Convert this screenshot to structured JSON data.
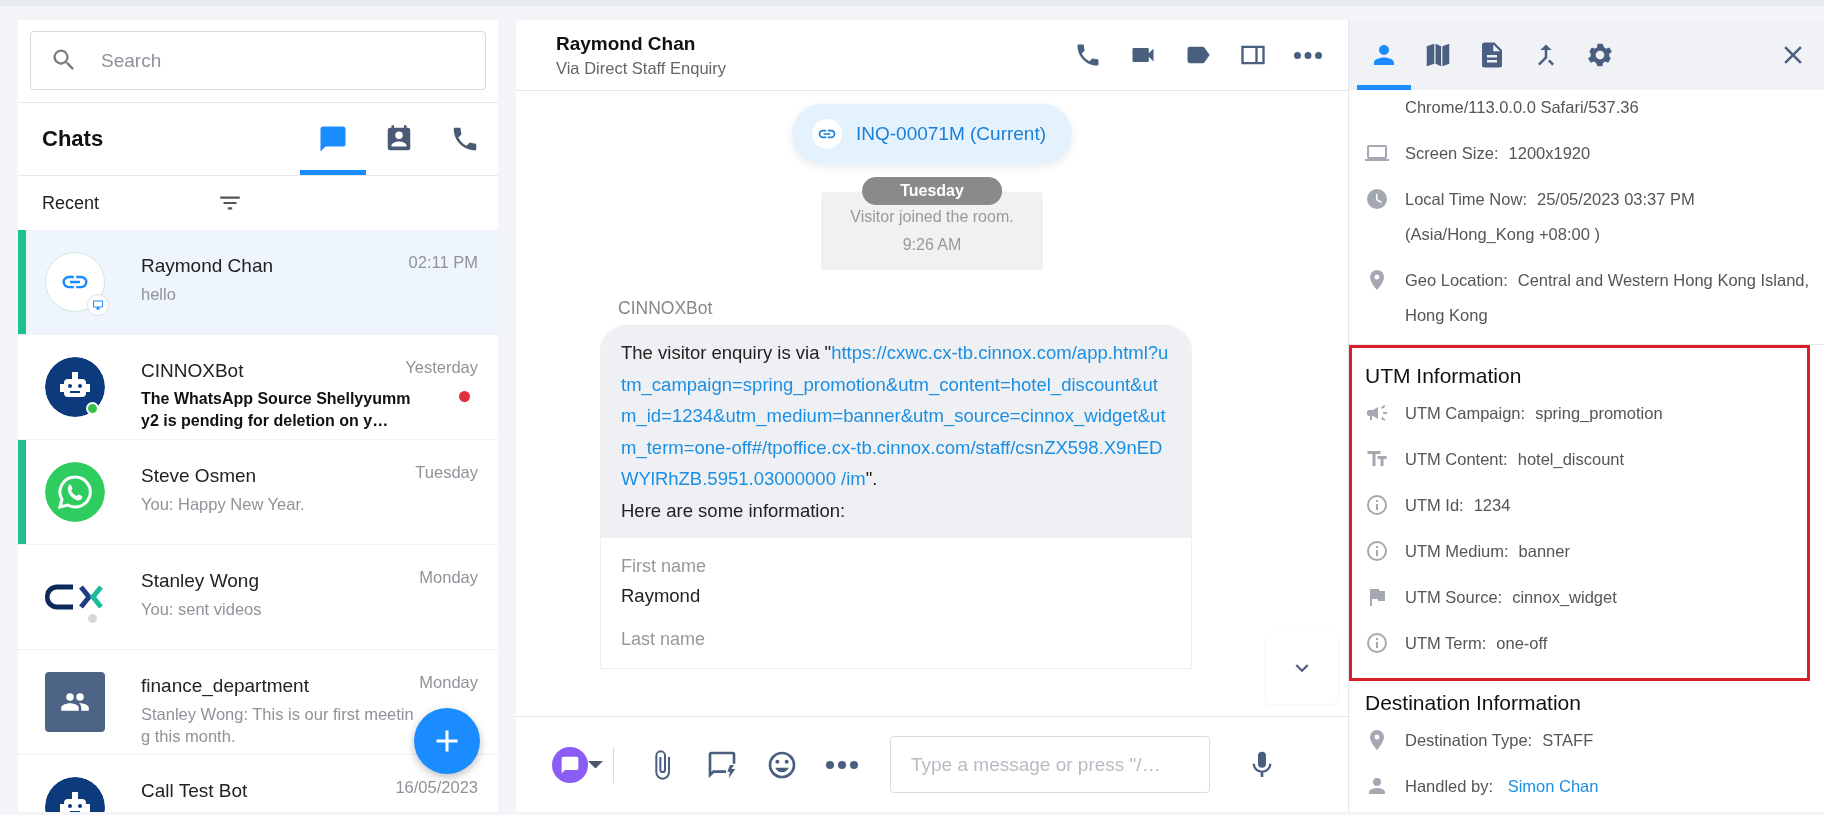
{
  "contact_list": {
    "search": {
      "placeholder": "Search"
    },
    "title": "Chats",
    "tabs": [
      {
        "kind": "chat",
        "selected": true
      },
      {
        "kind": "contacts",
        "selected": false
      },
      {
        "kind": "calls",
        "selected": false
      }
    ],
    "filter_label": "Recent",
    "chats": [
      {
        "name": "Raymond Chan",
        "preview": "hello",
        "time": "02:11 PM",
        "kind": "link",
        "selected": true,
        "accent": true
      },
      {
        "name": "CINNOXBot",
        "preview": "The WhatsApp Source Shellyyummy2 is pending for deletion on y…",
        "time": "Yesterday",
        "kind": "bot",
        "online": true,
        "selected": false,
        "unread": true
      },
      {
        "name": "Steve Osmen",
        "preview": "You: Happy New Year.",
        "time": "Tuesday",
        "kind": "whatsapp",
        "selected": false,
        "accent": true
      },
      {
        "name": "Stanley Wong",
        "preview": "You:  sent videos",
        "time": "Monday",
        "kind": "cx",
        "online": false,
        "selected": false
      },
      {
        "name": "finance_department",
        "preview": "Stanley Wong: This is our first meeting this month.",
        "time": "Monday",
        "kind": "group",
        "selected": false
      },
      {
        "name": "Call Test Bot",
        "time": "16/05/2023",
        "kind": "bot",
        "selected": false
      }
    ]
  },
  "conversation": {
    "name": "Raymond Chan",
    "subtitle": "Via Direct Staff Enquiry",
    "actions": [
      {
        "kind": "call"
      },
      {
        "kind": "video"
      },
      {
        "kind": "tag"
      },
      {
        "kind": "panel"
      },
      {
        "kind": "more"
      }
    ],
    "enquiry": "INQ-00071M (Current)",
    "date": "Tuesday",
    "system_message": "Visitor joined the room.",
    "system_time": "9:26 AM",
    "message": {
      "sender": "CINNOXBot",
      "intro": "The visitor enquiry is via \"",
      "link": "https://cxwc.cx-tb.cinnox.com/app.html?utm_campaign=spring_promotion&utm_content=hotel_discount&utm_id=1234&utm_medium=banner&utm_source=cinnox_widget&utm_term=one-off#/tpoffice.cx-tb.cinnox.com/staff/csnZX598.X9nEDWYlRhZB.5951.03000000  /im",
      "outro": "\".",
      "note": "Here are some information:",
      "fields": [
        {
          "label": "First name",
          "value": "Raymond"
        },
        {
          "label": "Last name"
        }
      ]
    },
    "composer": {
      "placeholder": "Type a message or press \"/…"
    }
  },
  "details": {
    "tabs": [
      {
        "kind": "profile",
        "selected": true
      },
      {
        "kind": "map",
        "selected": false
      },
      {
        "kind": "doc",
        "selected": false
      },
      {
        "kind": "merge",
        "selected": false
      },
      {
        "kind": "gear",
        "selected": false
      }
    ],
    "sections": [
      {
        "highlighted": false,
        "rows": [
          {
            "value": "Chrome/113.0.0.0 Safari/537.36"
          },
          {
            "kind": "laptop",
            "label": "Screen Size:",
            "value": "1200x1920"
          },
          {
            "kind": "clock",
            "label": "Local Time Now:",
            "value": "25/05/2023 03:37 PM (Asia/Hong_Kong +08:00 )"
          },
          {
            "kind": "pin",
            "label": "Geo Location:",
            "value": "Central and Western Hong Kong Island, Hong Kong"
          }
        ]
      },
      {
        "title": "UTM Information",
        "highlighted": true,
        "rows": [
          {
            "kind": "megaphone",
            "label": "UTM Campaign:",
            "value": "spring_promotion"
          },
          {
            "kind": "text",
            "label": "UTM Content:",
            "value": "hotel_discount"
          },
          {
            "kind": "info",
            "label": "UTM Id:",
            "value": "1234"
          },
          {
            "kind": "info",
            "label": "UTM Medium:",
            "value": "banner"
          },
          {
            "kind": "flag",
            "label": "UTM Source:",
            "value": "cinnox_widget"
          },
          {
            "kind": "info",
            "label": "UTM Term:",
            "value": "one-off"
          }
        ]
      },
      {
        "title": "Destination Information",
        "highlighted": false,
        "rows": [
          {
            "kind": "pin",
            "label": "Destination Type:",
            "value": "STAFF"
          },
          {
            "kind": "person",
            "label": "Handled by:",
            "value": "Simon Chan",
            "link": true
          }
        ]
      }
    ]
  }
}
